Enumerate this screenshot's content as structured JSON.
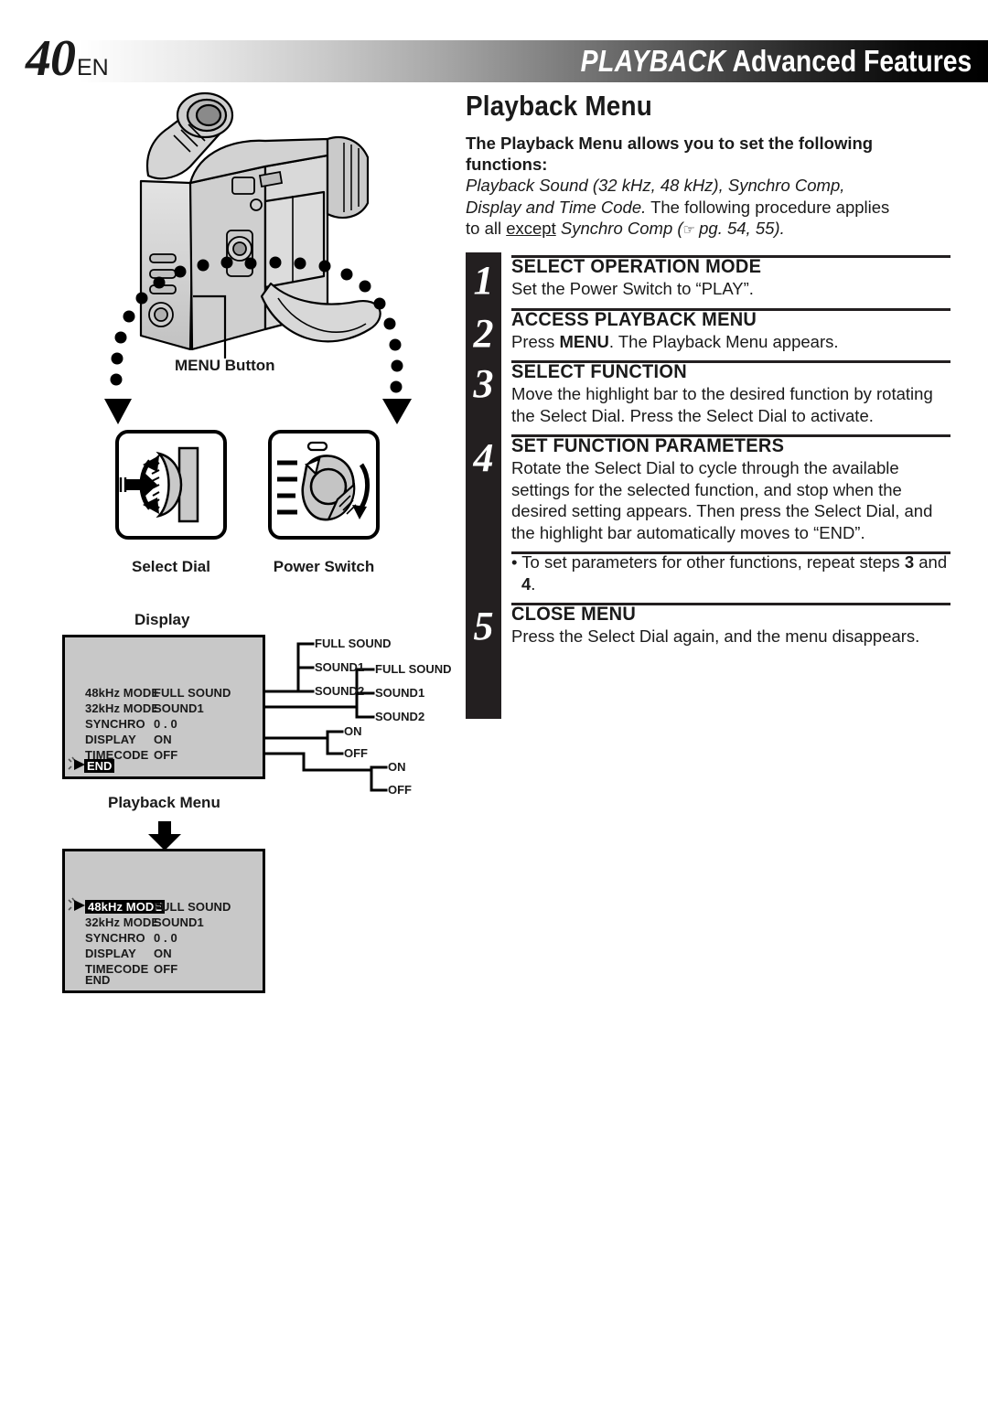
{
  "header": {
    "page_number": "40",
    "page_lang": "EN",
    "title_italic": "PLAYBACK",
    "title_bold": "Advanced Features"
  },
  "section": {
    "title": "Playback Menu",
    "intro_bold": "The Playback Menu allows you to set the following functions:",
    "intro_line1": "Playback Sound (32 kHz, 48 kHz), Synchro Comp,",
    "intro_line2_italic": "Display and Time Code.",
    "intro_line2_rest": " The following procedure applies",
    "intro_line3_a": "to all ",
    "intro_line3_underline": "except",
    "intro_line3_b": " Synchro Comp (",
    "intro_line3_hand": "☞",
    "intro_line3_c": " pg. 54, 55)."
  },
  "steps": [
    {
      "num": "1",
      "heading": "SELECT OPERATION MODE",
      "body": "Set the Power Switch to “PLAY”."
    },
    {
      "num": "2",
      "heading": "ACCESS PLAYBACK MENU",
      "body_pre": "Press ",
      "body_bold": "MENU",
      "body_post": ". The Playback Menu appears."
    },
    {
      "num": "3",
      "heading": "SELECT FUNCTION",
      "body": "Move the highlight bar to the desired function by rotating the Select Dial. Press the Select Dial to activate."
    },
    {
      "num": "4",
      "heading": "SET FUNCTION PARAMETERS",
      "body": "Rotate the Select Dial to cycle through the available settings for the selected function, and stop when the desired setting appears. Then press the Select Dial, and the highlight bar automatically moves to “END”."
    },
    {
      "num": "5",
      "heading": "CLOSE MENU",
      "body": "Press the Select Dial again, and the menu disappears."
    }
  ],
  "bullet": {
    "pre": "• To set parameters for other functions, repeat steps ",
    "bold1": "3",
    "mid": " and ",
    "bold2": "4",
    "post": "."
  },
  "illustration": {
    "menu_button_label": "MENU Button",
    "select_dial_label": "Select Dial",
    "power_switch_label": "Power Switch"
  },
  "display": {
    "display_label": "Display",
    "playback_menu_label": "Playback Menu",
    "panel1": {
      "rows": [
        {
          "label": "48kHz  MODE",
          "value": "FULL SOUND"
        },
        {
          "label": "32kHz  MODE",
          "value": "SOUND1"
        },
        {
          "label": "SYNCHRO",
          "value": "0 . 0"
        },
        {
          "label": "DISPLAY",
          "value": "ON"
        },
        {
          "label": "TIMECODE",
          "value": "OFF"
        }
      ],
      "end_label": "END",
      "end_highlighted": true,
      "highlighted_row": -1
    },
    "panel2": {
      "rows": [
        {
          "label": "48kHz  MODE",
          "value": "FULL SOUND"
        },
        {
          "label": "32kHz  MODE",
          "value": "SOUND1"
        },
        {
          "label": "SYNCHRO",
          "value": "0 . 0"
        },
        {
          "label": "DISPLAY",
          "value": "ON"
        },
        {
          "label": "TIMECODE",
          "value": "OFF"
        }
      ],
      "end_label": "END",
      "end_highlighted": false,
      "highlighted_row": 0
    },
    "branches": {
      "group_48khz": [
        "FULL SOUND",
        "SOUND1",
        "SOUND2"
      ],
      "group_32khz": [
        "FULL SOUND",
        "SOUND1",
        "SOUND2"
      ],
      "group_display": [
        "ON",
        "OFF"
      ],
      "group_timecode": [
        "ON",
        "OFF"
      ]
    }
  },
  "colors": {
    "ink": "#231f20",
    "panel_bg": "#c8c8c8",
    "device_body": "#d5d5d5",
    "device_shade": "#b5b5b5"
  }
}
